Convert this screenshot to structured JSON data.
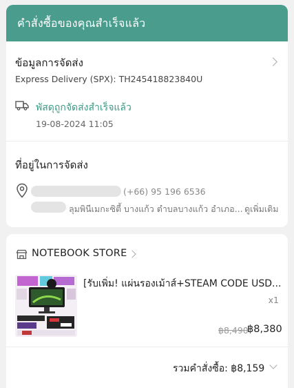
{
  "header": {
    "title": "คำสั่งซื้อของคุณสำเร็จแล้ว",
    "color": "#4a9d8d"
  },
  "shipping": {
    "title": "ข้อมูลการจัดส่ง",
    "tracking": "Express Delivery (SPX): TH245418823840U",
    "status": "พัสดุถูกจัดส่งสำเร็จแล้ว",
    "status_time": "19-08-2024 11:05",
    "status_color": "#3a9b86"
  },
  "address": {
    "title": "ที่อยู่ในการจัดส่ง",
    "phone": "(+66) 95 196 6536",
    "line": "ลุมพินีเมกะซิตี้ บางแก้ว ตำบลบางแก้ว อำเภอ...",
    "see_more": "ดูเพิ่มเติม"
  },
  "store": {
    "name": "NOTEBOOK STORE",
    "product_title": "[รับเพิ่ม! แผ่นรองเม้าส์+STEAM CODE USD...",
    "quantity": "x1",
    "original_price": "฿8,490",
    "price": "฿8,380",
    "total_label": "รวมคำสั่งซื้อ: ฿8,159"
  }
}
